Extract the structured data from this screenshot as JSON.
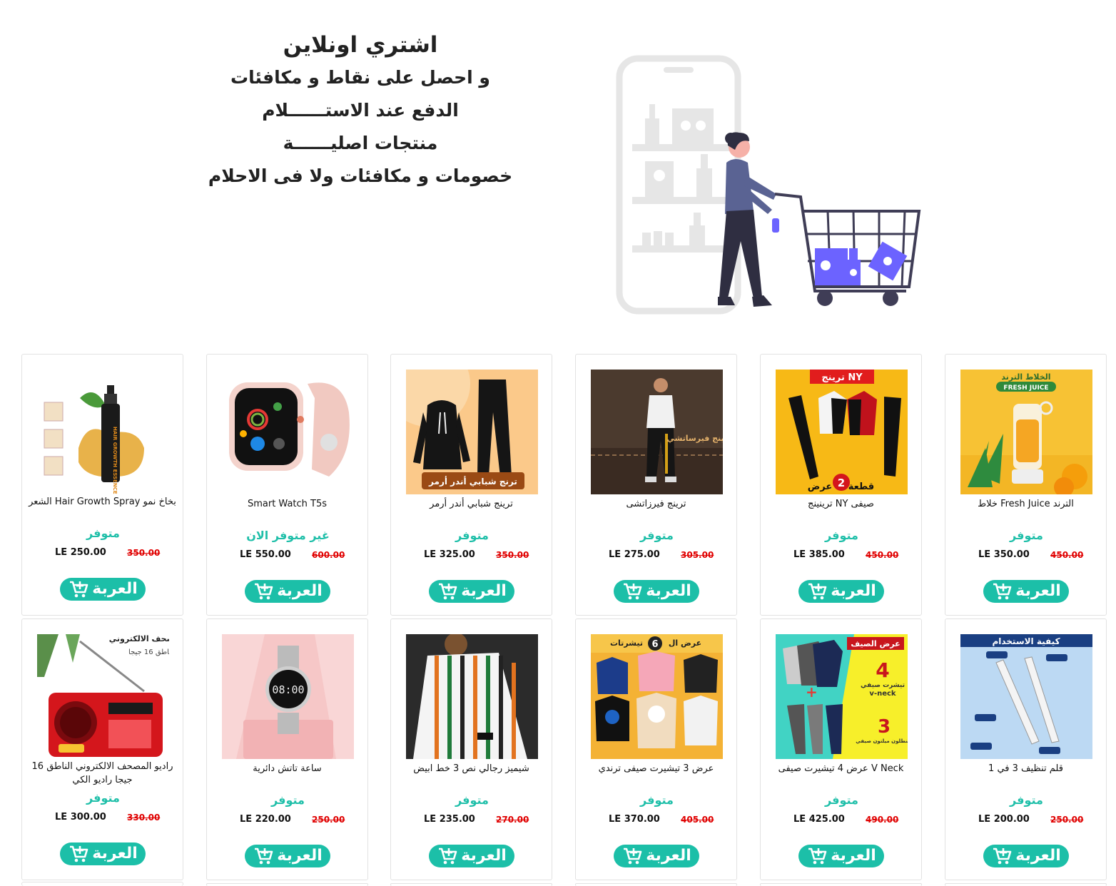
{
  "hero": {
    "lines": [
      "اشتري اونلاين",
      "و احصل على نقاط و مكافئات",
      "الدفع عند الاستــــــلام",
      "منتجات اصليــــــة",
      "خصومات و مكافئات ولا فى الاحلام"
    ],
    "illustration_icon": "shopping-cart-illustration"
  },
  "cart_button_label": "العربة",
  "currency": "LE",
  "colors": {
    "accent": "#1cbfa8",
    "available": "#1fbfa9",
    "old_price": "#e00000"
  },
  "products": [
    {
      "title": "الترند Fresh Juice خلاط",
      "stock": "متوفر",
      "price": "LE 350.00",
      "old_price": "450.00"
    },
    {
      "title": "صيفى NY ترينينج",
      "stock": "متوفر",
      "price": "LE 385.00",
      "old_price": "450.00"
    },
    {
      "title": "ترينج فيرزاتشى",
      "stock": "متوفر",
      "price": "LE 275.00",
      "old_price": "305.00"
    },
    {
      "title": "ترينج شبابي أندر أرمر",
      "stock": "متوفر",
      "price": "LE 325.00",
      "old_price": "350.00"
    },
    {
      "title": "Smart Watch T5s",
      "stock": "غير متوفر الان",
      "price": "LE 550.00",
      "old_price": "600.00"
    },
    {
      "title": "بخاخ نمو Hair Growth Spray الشعر",
      "stock": "متوفر",
      "price": "LE 250.00",
      "old_price": "350.00"
    },
    {
      "title": "قلم تنظيف 3 في 1",
      "stock": "متوفر",
      "price": "LE 200.00",
      "old_price": "250.00"
    },
    {
      "title": "V Neck عرض 4 تيشيرت صيفى",
      "stock": "متوفر",
      "price": "LE 425.00",
      "old_price": "490.00"
    },
    {
      "title": "عرض 3 تيشيرت صيفى ترندي",
      "stock": "متوفر",
      "price": "LE 370.00",
      "old_price": "405.00"
    },
    {
      "title": "شيميز رجالي نص 3 خط ابيض",
      "stock": "متوفر",
      "price": "LE 235.00",
      "old_price": "270.00"
    },
    {
      "title": "ساعة تاتش دائرية",
      "stock": "متوفر",
      "price": "LE 220.00",
      "old_price": "250.00"
    },
    {
      "title": "راديو المصحف الالكتروني الناطق 16 جيجا راديو الكي",
      "stock": "متوفر",
      "price": "LE 300.00",
      "old_price": "330.00"
    }
  ],
  "image_texts": {
    "blender_top": "الخلاط الترند",
    "blender_badge": "FRESH JUICE",
    "ny_banner": "ترينج NY",
    "ny_offer": "عرض",
    "ny_offer_num": "2",
    "ny_offer_unit": "قطعة",
    "versace_label": "ترينج فيرساتشي",
    "ua_label": "ترنج شبابي أندر أرمر",
    "spray_label": "HAIR GROWTH ESSENCE SPRAY",
    "pen_title": "كيفية الاستخدام",
    "summer_offer": "عرض الصيف",
    "summer_num4": "4",
    "summer_tshirt": "تيشرت صيفي",
    "summer_vneck": "v-neck",
    "summer_num3": "3",
    "summer_pants": "بنطلون ميلتون صيفي",
    "six_offer": "عرض ال",
    "six_num": "6",
    "six_tshirts": "تيشرتات",
    "watch_time": "08:00",
    "radio_title": "مصحف الالكتروني",
    "radio_sub": "ناطق 16 جيجا"
  }
}
